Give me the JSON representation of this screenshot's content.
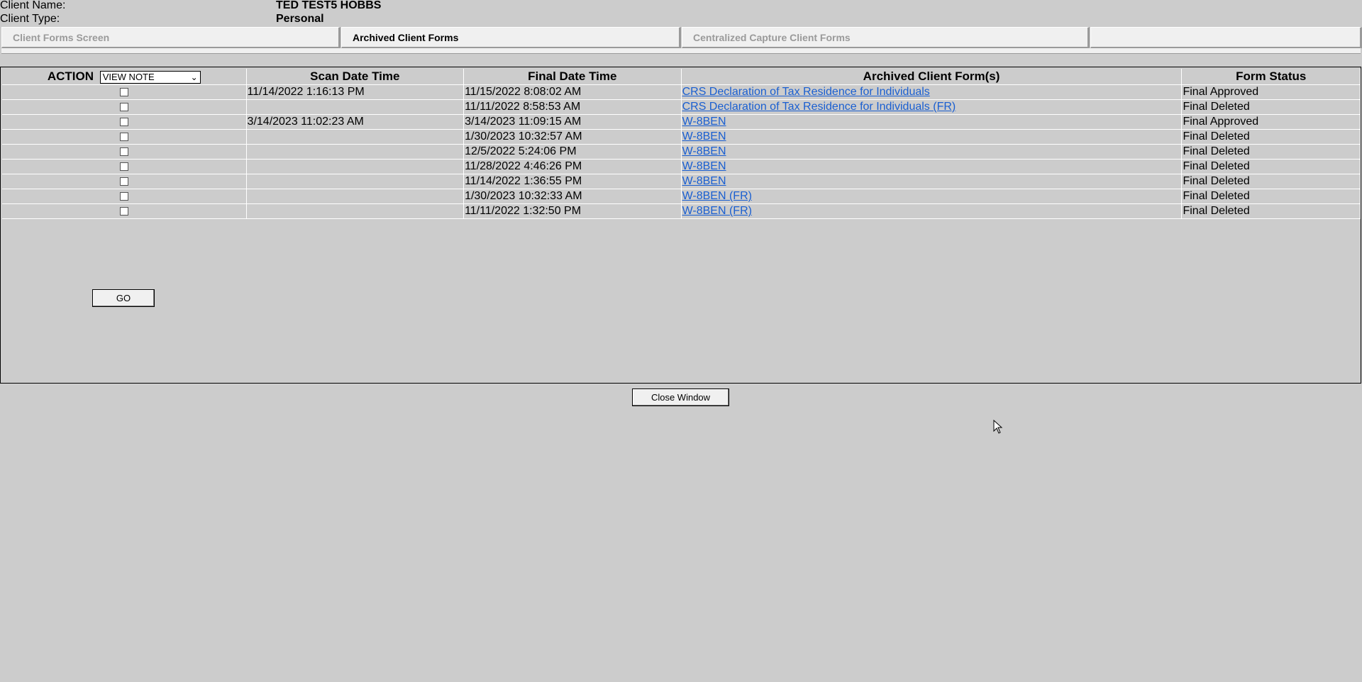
{
  "client": {
    "name_label": "Client Name:",
    "name_value": "TED TEST5 HOBBS",
    "type_label": "Client Type:",
    "type_value": "Personal"
  },
  "tabs": [
    {
      "label": "Client Forms Screen",
      "active": false
    },
    {
      "label": "Archived Client Forms",
      "active": true
    },
    {
      "label": "Centralized Capture Client Forms",
      "active": false
    },
    {
      "label": "",
      "active": false
    }
  ],
  "table": {
    "action_label": "ACTION",
    "action_select_value": "VIEW NOTE",
    "headers": {
      "scan": "Scan Date Time",
      "final": "Final Date Time",
      "form": "Archived Client Form(s)",
      "status": "Form Status"
    },
    "rows": [
      {
        "scan": "11/14/2022 1:16:13 PM",
        "final": "11/15/2022 8:08:02 AM",
        "form": "CRS Declaration of Tax Residence for Individuals",
        "status": "Final Approved"
      },
      {
        "scan": "",
        "final": "11/11/2022 8:58:53 AM",
        "form": "CRS Declaration of Tax Residence for Individuals (FR)",
        "status": "Final Deleted"
      },
      {
        "scan": "3/14/2023 11:02:23 AM",
        "final": "3/14/2023 11:09:15 AM",
        "form": "W-8BEN",
        "status": "Final Approved"
      },
      {
        "scan": "",
        "final": "1/30/2023 10:32:57 AM",
        "form": "W-8BEN",
        "status": "Final Deleted"
      },
      {
        "scan": "",
        "final": "12/5/2022 5:24:06 PM",
        "form": "W-8BEN",
        "status": "Final Deleted"
      },
      {
        "scan": "",
        "final": "11/28/2022 4:46:26 PM",
        "form": "W-8BEN",
        "status": "Final Deleted"
      },
      {
        "scan": "",
        "final": "11/14/2022 1:36:55 PM",
        "form": "W-8BEN",
        "status": "Final Deleted"
      },
      {
        "scan": "",
        "final": "1/30/2023 10:32:33 AM",
        "form": "W-8BEN (FR)",
        "status": "Final Deleted"
      },
      {
        "scan": "",
        "final": "11/11/2022 1:32:50 PM",
        "form": "W-8BEN (FR)",
        "status": "Final Deleted"
      }
    ]
  },
  "buttons": {
    "go": "GO",
    "close": "Close Window"
  },
  "colors": {
    "background": "#cccccc",
    "link": "#1a5fd1",
    "tab_inactive_text": "#9a9a9a"
  }
}
